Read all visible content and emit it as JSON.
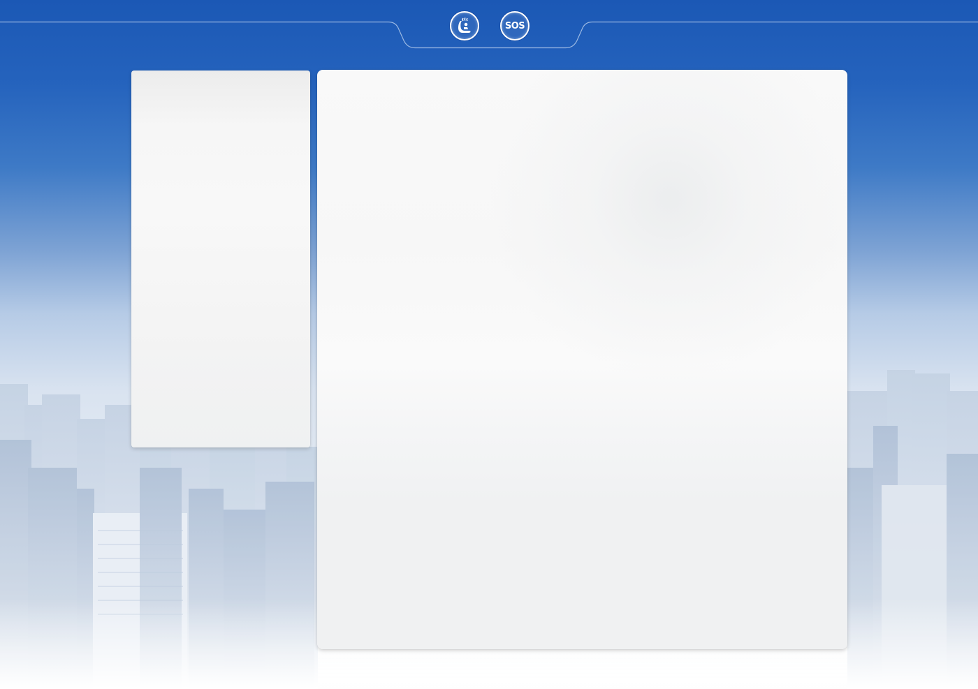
{
  "header": {
    "seat_icon": "massage-seat-icon",
    "sos_label": "SOS"
  },
  "panels": {
    "left": "content-panel",
    "main": "content-panel"
  },
  "colors": {
    "sky_top": "#1b58b5",
    "sky_bottom": "#ffffff",
    "panel_bg": "#f5f5f5",
    "line": "#a9c3e8"
  }
}
